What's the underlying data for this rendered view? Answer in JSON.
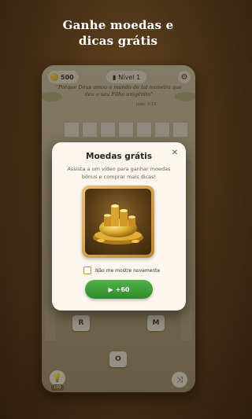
{
  "headline": {
    "line1": "Ganhe moedas e",
    "line2": "dicas grátis"
  },
  "game": {
    "coins": "500",
    "coin_icon": "coin-icon",
    "level_label": "Nível 1",
    "settings_icon": "gear-icon",
    "verse": "\"Porque Deus amou o mundo de tal maneira que deu o seu Filho unigênito\"",
    "verse_ref": "João 3:16",
    "letters": [
      "R",
      "M",
      "O"
    ],
    "hint_cost": "100",
    "hint_icon": "lightbulb-icon",
    "shuffle_icon": "shuffle-icon"
  },
  "modal": {
    "title": "Moedas grátis",
    "close_icon": "close-icon",
    "description": "Assista a um vídeo para ganhar moedas bônus e comprar mais dicas!",
    "reward_image": "gold-coins-bowl-image",
    "checkbox_label": "Não me mostre novamente",
    "checkbox_checked": false,
    "button_label": "+60",
    "button_icon": "play-icon"
  },
  "colors": {
    "background": "#4a3117",
    "modal_bg": "#fbf7ef",
    "button_green": "#2f8a2b",
    "gold": "#c98f2e"
  }
}
